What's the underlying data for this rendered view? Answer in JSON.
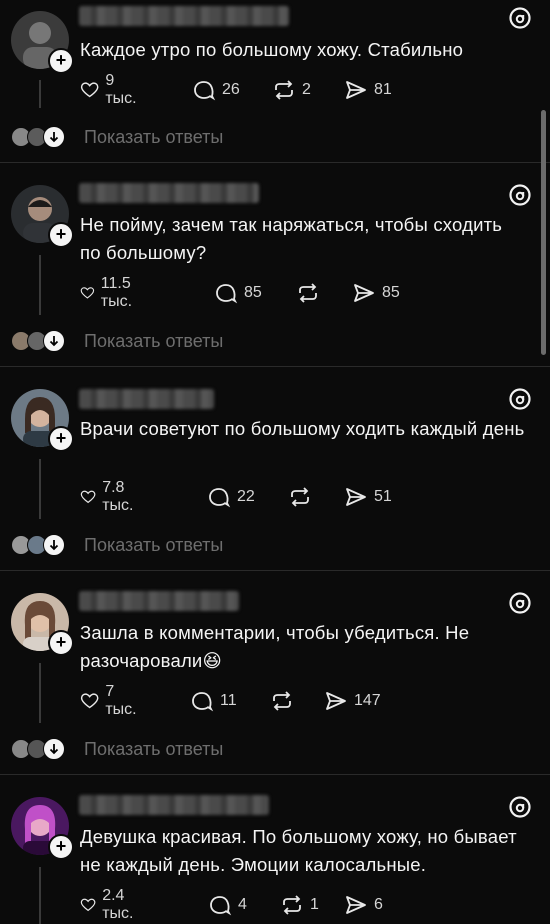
{
  "posts": [
    {
      "text": "Каждое утро по большому хожу. Стабильно",
      "likes": "9 тыс.",
      "comments": "26",
      "reposts": "2",
      "shares": "81",
      "show_replies": "Показать ответы",
      "avatar_color": "#5a5a5a"
    },
    {
      "text": "Не пойму, зачем так наряжаться, чтобы сходить по большому?",
      "likes": "11.5 тыс.",
      "comments": "85",
      "reposts": "",
      "shares": "85",
      "show_replies": "Показать ответы",
      "avatar_color": "#4a4f55"
    },
    {
      "text": "Врачи советуют по большому ходить каждый день",
      "likes": "7.8 тыс.",
      "comments": "22",
      "reposts": "",
      "shares": "51",
      "show_replies": "Показать ответы",
      "avatar_color": "#7a6258"
    },
    {
      "text": "Зашла в комментарии, чтобы убедиться. Не разочаровали😆",
      "likes": "7 тыс.",
      "comments": "11",
      "reposts": "",
      "shares": "147",
      "show_replies": "Показать ответы",
      "avatar_color": "#8a6a5a"
    },
    {
      "text": "Девушка красивая. По большому хожу, но бывает не каждый день. Эмоции калосальные.",
      "likes": "2.4 тыс.",
      "comments": "4",
      "reposts": "1",
      "shares": "6",
      "show_replies": "",
      "avatar_color": "#9a3aa8"
    }
  ],
  "icons": {
    "like": "heart-icon",
    "comment": "comment-icon",
    "repost": "repost-icon",
    "share": "share-icon",
    "brand": "threads-logo-icon",
    "plus": "follow-plus-icon",
    "expand": "chevron-down-icon"
  }
}
